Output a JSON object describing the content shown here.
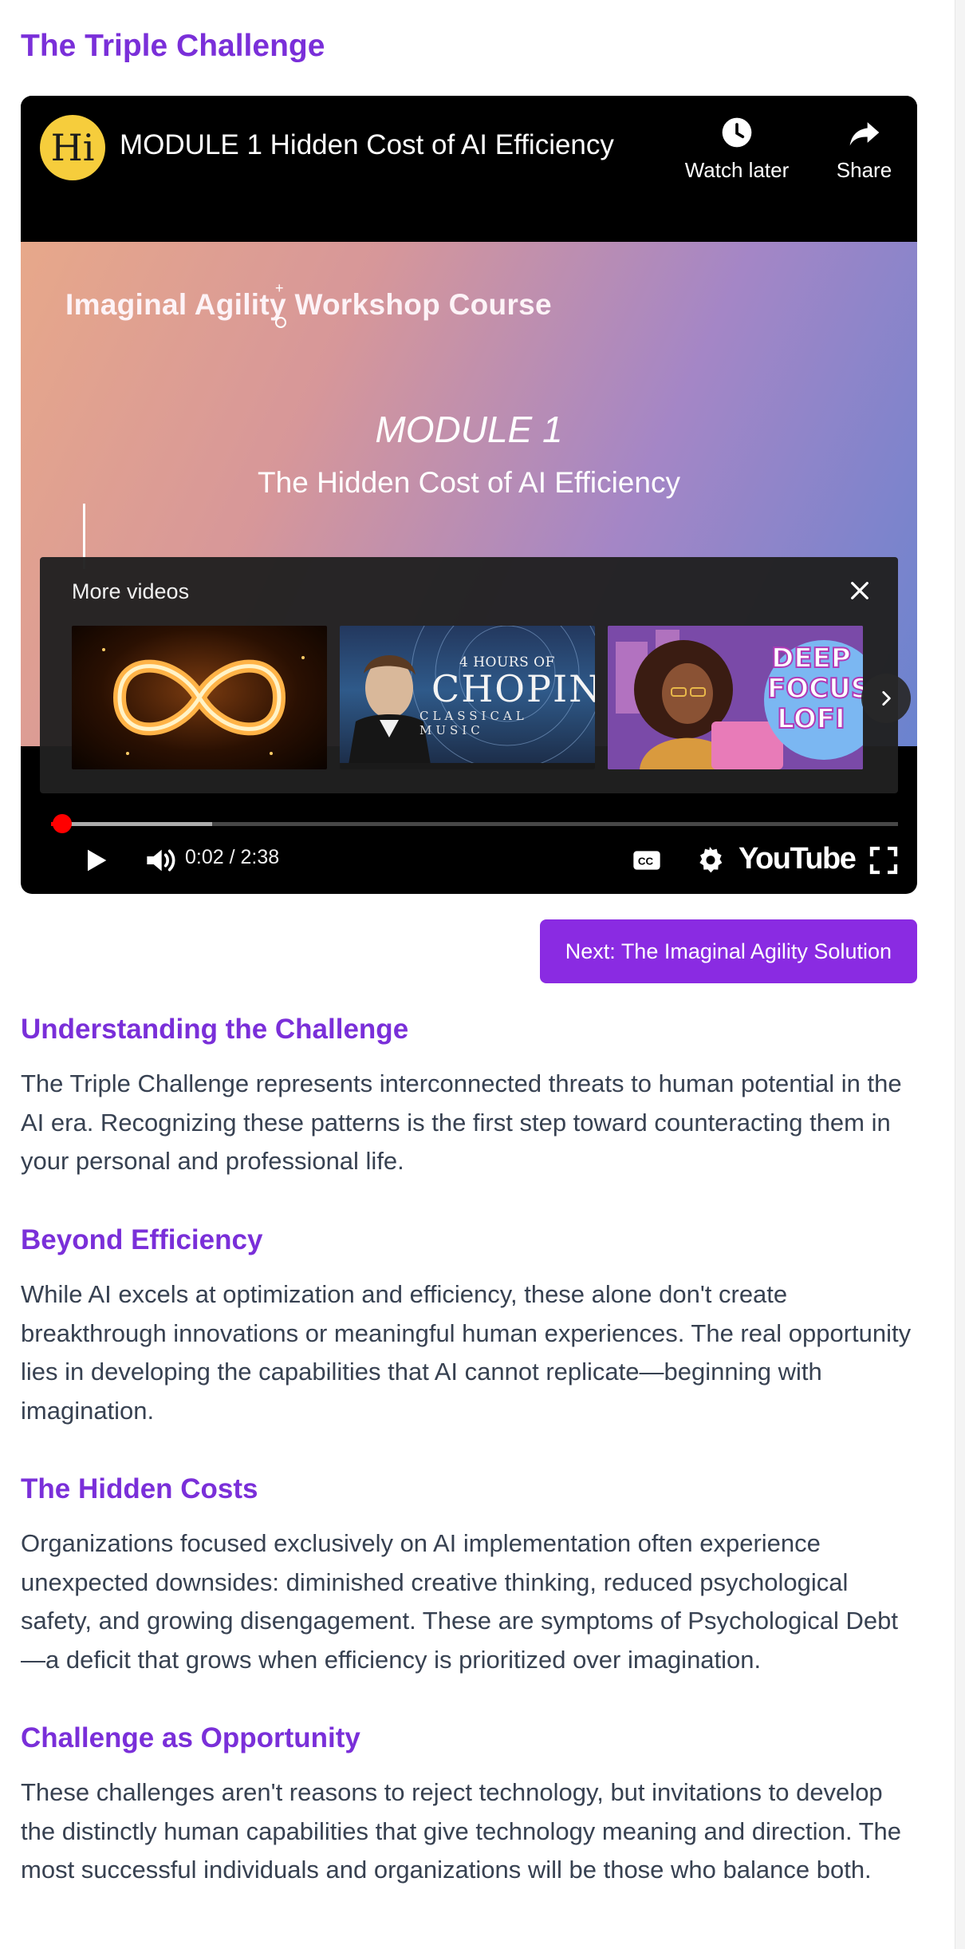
{
  "page": {
    "title": "The Triple Challenge"
  },
  "video": {
    "channel_avatar_text": "Hi",
    "title": "MODULE 1 Hidden Cost of AI Efficiency",
    "watch_later_label": "Watch later",
    "share_label": "Share",
    "slide": {
      "course_name": "Imaginal Agility Workshop Course",
      "module": "MODULE 1",
      "subtitle": "The Hidden Cost of AI Efficiency"
    },
    "more_videos": {
      "title": "More videos",
      "thumbnails": [
        {
          "caption": ""
        },
        {
          "caption_small": "4 HOURS OF",
          "caption_big": "CHOPIN",
          "caption_sub": "CLASSICAL MUSIC"
        },
        {
          "caption": "DEEP FOCUS LOFI"
        }
      ]
    },
    "time_display": "0:02 / 2:38",
    "progress_fraction": 0.013,
    "buffered_fraction": 0.19,
    "youtube_logo": "YouTube",
    "colors": {
      "accent": "#7a2fd9",
      "button": "#8a2be2",
      "progress": "#ff0000"
    }
  },
  "next_button_label": "Next: The Imaginal Agility Solution",
  "sections": [
    {
      "heading": "Understanding the Challenge",
      "body": "The Triple Challenge represents interconnected threats to human potential in the AI era. Recognizing these patterns is the first step toward counteracting them in your personal and professional life."
    },
    {
      "heading": "Beyond Efficiency",
      "body": "While AI excels at optimization and efficiency, these alone don't create breakthrough innovations or meaningful human experiences. The real opportunity lies in developing the capabilities that AI cannot replicate—beginning with imagination."
    },
    {
      "heading": "The Hidden Costs",
      "body": "Organizations focused exclusively on AI implementation often experience unexpected downsides: diminished creative thinking, reduced psychological safety, and growing disengagement. These are symptoms of Psychological Debt—a deficit that grows when efficiency is prioritized over imagination."
    },
    {
      "heading": "Challenge as Opportunity",
      "body": "These challenges aren't reasons to reject technology, but invitations to develop the distinctly human capabilities that give technology meaning and direction. The most successful individuals and organizations will be those who balance both."
    }
  ]
}
